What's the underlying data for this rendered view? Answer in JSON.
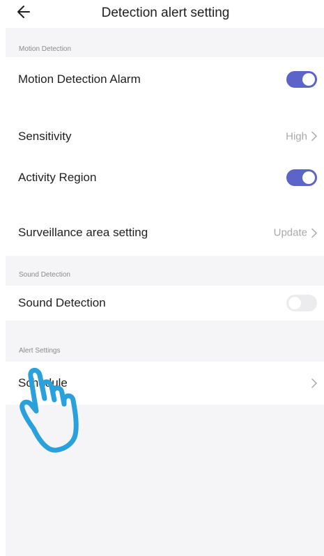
{
  "header": {
    "title": "Detection alert setting",
    "back_icon": "arrow-left-icon"
  },
  "sections": [
    {
      "title": "Motion Detection",
      "rows": [
        {
          "label": "Motion Detection Alarm",
          "type": "toggle",
          "on": true
        },
        {
          "label": "Sensitivity",
          "type": "value",
          "value": "High"
        },
        {
          "label": "Activity Region",
          "type": "toggle",
          "on": true
        },
        {
          "label": "Surveillance area setting",
          "type": "value",
          "value": "Update"
        }
      ]
    },
    {
      "title": "Sound Detection",
      "rows": [
        {
          "label": "Sound Detection",
          "type": "toggle",
          "on": false
        }
      ]
    },
    {
      "title": "Alert Settings",
      "rows": [
        {
          "label": "Schedule",
          "type": "chevron"
        }
      ]
    }
  ],
  "colors": {
    "toggle_on": "#5c63c9",
    "toggle_off": "#ececef",
    "background": "#f5f5f7",
    "hand_pointer": "#2aa1dd"
  },
  "overlay": {
    "icon": "hand-pointer-icon"
  }
}
